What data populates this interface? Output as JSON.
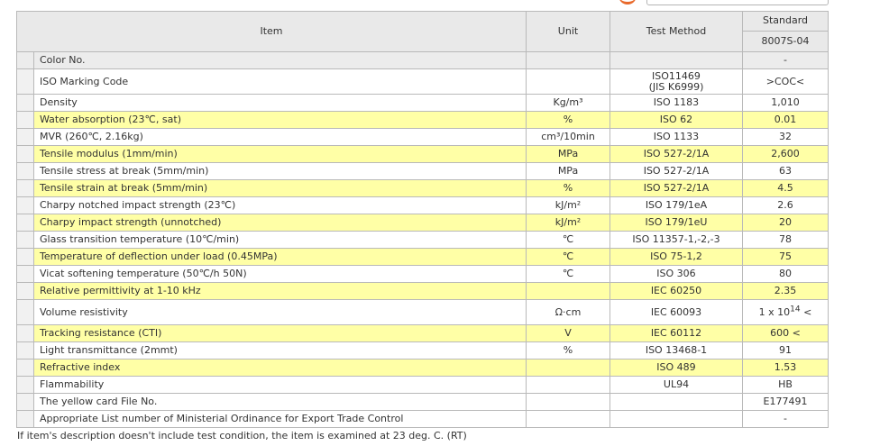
{
  "header": {
    "item": "Item",
    "unit": "Unit",
    "test_method": "Test Method",
    "standard": "Standard",
    "grade": "8007S-04"
  },
  "rows": [
    {
      "item": "Color No.",
      "unit": "",
      "method": "",
      "value": "-"
    },
    {
      "item": "ISO Marking Code",
      "unit": "",
      "method_line1": "ISO11469",
      "method_line2": "(JIS K6999)",
      "value": ">COC<"
    },
    {
      "item": "Density",
      "unit": "Kg/m³",
      "method": "ISO 1183",
      "value": "1,010"
    },
    {
      "item": "Water absorption (23℃, sat)",
      "unit": "%",
      "method": "ISO 62",
      "value": "0.01"
    },
    {
      "item": "MVR (260℃, 2.16kg)",
      "unit": "cm³/10min",
      "method": "ISO 1133",
      "value": "32"
    },
    {
      "item": "Tensile modulus (1mm/min)",
      "unit": "MPa",
      "method": "ISO 527-2/1A",
      "value": "2,600"
    },
    {
      "item": "Tensile stress at break (5mm/min)",
      "unit": "MPa",
      "method": "ISO 527-2/1A",
      "value": "63"
    },
    {
      "item": "Tensile strain at break (5mm/min)",
      "unit": "%",
      "method": "ISO 527-2/1A",
      "value": "4.5"
    },
    {
      "item": "Charpy notched impact strength (23℃)",
      "unit": "kJ/m²",
      "method": "ISO 179/1eA",
      "value": "2.6"
    },
    {
      "item": "Charpy impact strength (unnotched)",
      "unit": "kJ/m²",
      "method": "ISO 179/1eU",
      "value": "20"
    },
    {
      "item": "Glass transition temperature (10℃/min)",
      "unit": "℃",
      "method": "ISO 11357-1,-2,-3",
      "value": "78"
    },
    {
      "item": "Temperature of deflection under load (0.45MPa)",
      "unit": "℃",
      "method": "ISO 75-1,2",
      "value": "75"
    },
    {
      "item": "Vicat softening temperature (50℃/h 50N)",
      "unit": "℃",
      "method": "ISO 306",
      "value": "80"
    },
    {
      "item": "Relative permittivity at 1-10 kHz",
      "unit": "",
      "method": "IEC 60250",
      "value": "2.35"
    },
    {
      "item": "Volume resistivity",
      "unit": "Ω·cm",
      "method": "IEC 60093",
      "value_base": "1 x 10",
      "value_exp": "14",
      "value_suffix": " <"
    },
    {
      "item": "Tracking resistance (CTI)",
      "unit": "V",
      "method": "IEC 60112",
      "value": "600 <"
    },
    {
      "item": "Light transmittance (2mmt)",
      "unit": "%",
      "method": "ISO 13468-1",
      "value": "91"
    },
    {
      "item": "Refractive index",
      "unit": "",
      "method": "ISO 489",
      "value": "1.53"
    },
    {
      "item": "Flammability",
      "unit": "",
      "method": "UL94",
      "value": "HB"
    },
    {
      "item": "The yellow card File No.",
      "unit": "",
      "method": "",
      "value": "E177491"
    },
    {
      "item": "Appropriate List number of Ministerial Ordinance for Export Trade Control",
      "unit": "",
      "method": "",
      "value": "-"
    }
  ],
  "footnote": "If item's description doesn't include test condition, the item is examined at 23 deg. C. (RT)",
  "colors": {
    "highlight": "#ffffa6",
    "header_bg": "#e9e9e9",
    "border": "#b9b9b9",
    "accent": "#e8692b"
  }
}
